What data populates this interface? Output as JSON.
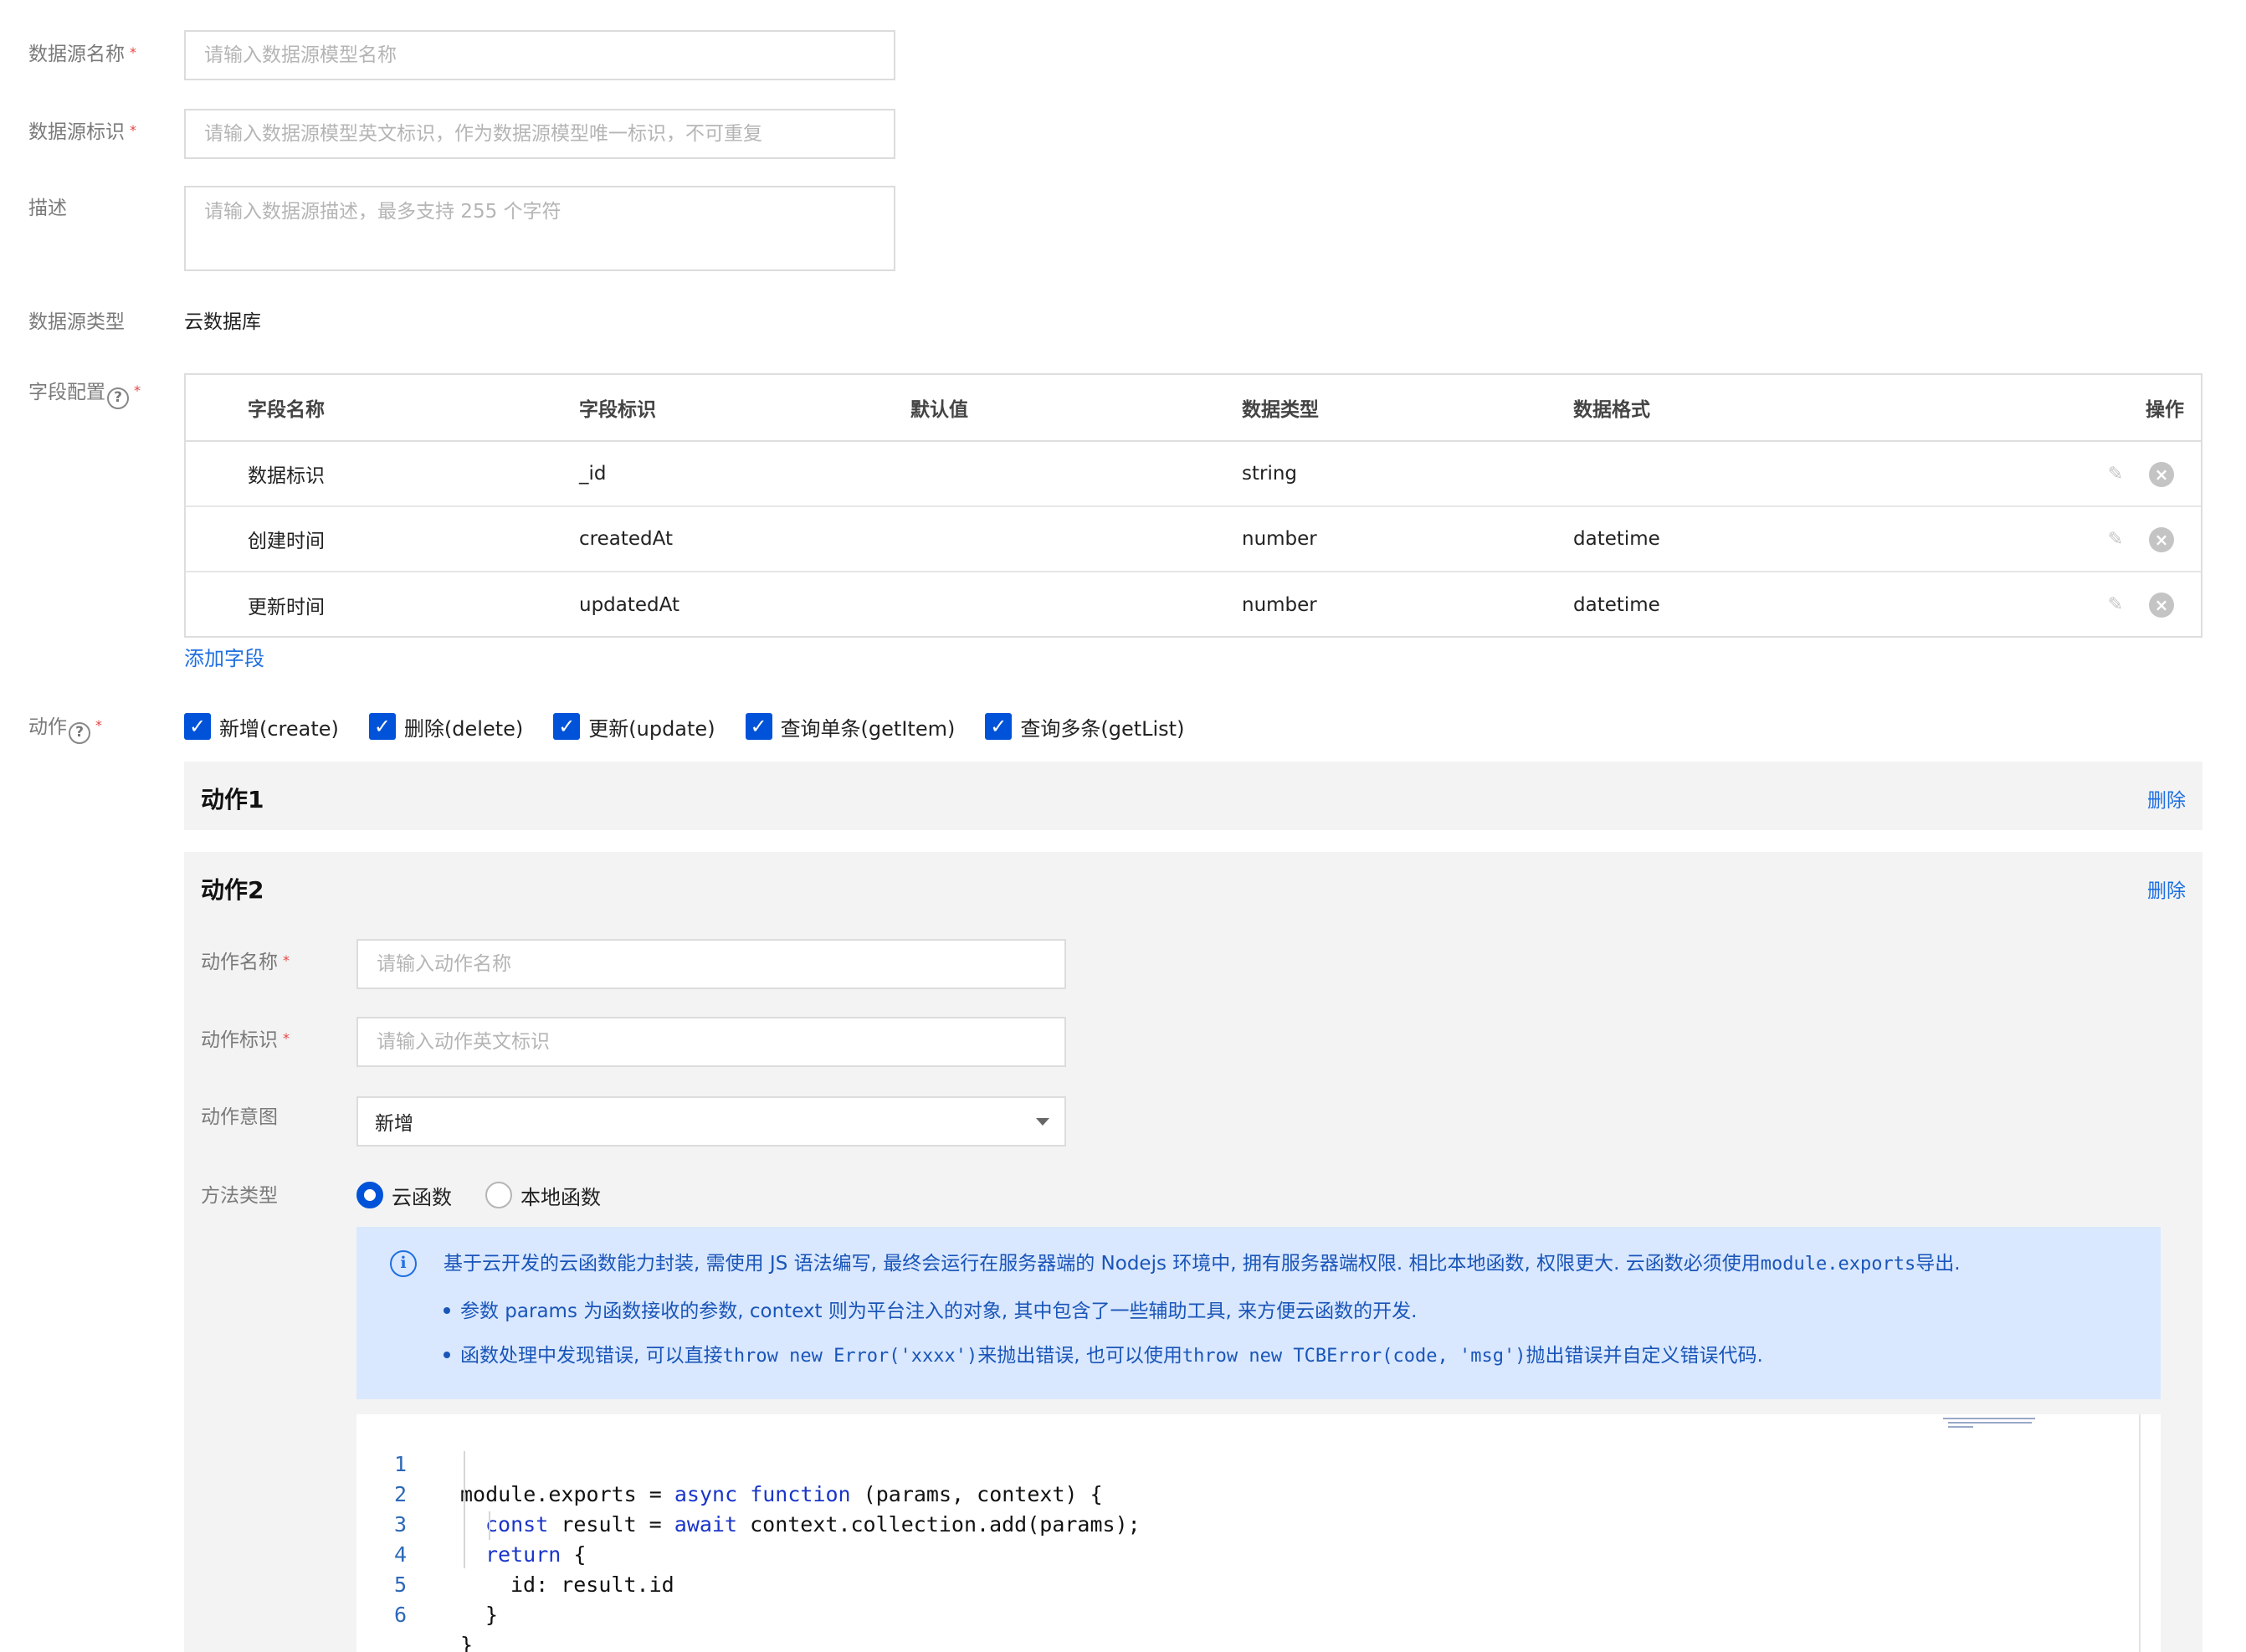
{
  "form": {
    "name": {
      "label": "数据源名称",
      "placeholder": "请输入数据源模型名称"
    },
    "identifier": {
      "label": "数据源标识",
      "placeholder": "请输入数据源模型英文标识，作为数据源模型唯一标识，不可重复"
    },
    "description": {
      "label": "描述",
      "placeholder": "请输入数据源描述，最多支持 255 个字符"
    },
    "type": {
      "label": "数据源类型",
      "value": "云数据库"
    },
    "fields": {
      "label": "字段配置"
    },
    "required_mark": "*",
    "help_glyph": "?"
  },
  "fields_table": {
    "headers": [
      "字段名称",
      "字段标识",
      "默认值",
      "数据类型",
      "数据格式",
      "操作"
    ],
    "rows": [
      {
        "name": "数据标识",
        "key": "_id",
        "default": "",
        "type": "string",
        "format": ""
      },
      {
        "name": "创建时间",
        "key": "createdAt",
        "default": "",
        "type": "number",
        "format": "datetime"
      },
      {
        "name": "更新时间",
        "key": "updatedAt",
        "default": "",
        "type": "number",
        "format": "datetime"
      }
    ],
    "add_label": "添加字段"
  },
  "actions": {
    "label": "动作",
    "options": [
      {
        "label": "新增(create)",
        "checked": true
      },
      {
        "label": "删除(delete)",
        "checked": true
      },
      {
        "label": "更新(update)",
        "checked": true
      },
      {
        "label": "查询单条(getItem)",
        "checked": true
      },
      {
        "label": "查询多条(getList)",
        "checked": true
      }
    ],
    "delete_label": "删除",
    "panels": [
      {
        "title": "动作1"
      },
      {
        "title": "动作2",
        "name": {
          "label": "动作名称",
          "placeholder": "请输入动作名称"
        },
        "identifier": {
          "label": "动作标识",
          "placeholder": "请输入动作英文标识"
        },
        "intent": {
          "label": "动作意图",
          "value": "新增"
        },
        "method": {
          "label": "方法类型",
          "options": [
            {
              "label": "云函数",
              "selected": true
            },
            {
              "label": "本地函数",
              "selected": false
            }
          ]
        },
        "info": {
          "line1": "基于云开发的云函数能力封装, 需使用 JS 语法编写, 最终会运行在服务器端的 Nodejs 环境中, 拥有服务器端权限. 相比本地函数, 权限更大. 云函数必须使用",
          "line1_code": "module.exports",
          "line1_end": "导出.",
          "line2": "参数 params 为函数接收的参数, context 则为平台注入的对象, 其中包含了一些辅助工具, 来方便云函数的开发.",
          "line3_a": "函数处理中发现错误, 可以直接",
          "line3_code1": "throw new Error('xxxx')",
          "line3_b": "来抛出错误, 也可以使用",
          "line3_code2": "throw new TCBError(code, 'msg')",
          "line3_c": "抛出错误并自定义错误代码."
        },
        "code": {
          "lines": [
            "1",
            "2",
            "3",
            "4",
            "5",
            "6"
          ],
          "tokens": {
            "l1a": "module.exports = ",
            "l1kw1": "async",
            "l1sp": " ",
            "l1kw2": "function",
            "l1b": " (params, context) {",
            "l2kw1": "const",
            "l2a": " result = ",
            "l2kw2": "await",
            "l2b": " context.collection.add(params);",
            "l3kw": "return",
            "l3a": " {",
            "l4": "id: result.id",
            "l5": "}",
            "l6": "}"
          }
        }
      }
    ]
  },
  "colors": {
    "primary": "#0052d9",
    "link": "#1f6fe0",
    "required": "#e54545",
    "info_bg": "#d9e8ff"
  },
  "icons": {
    "edit": "pencil-icon",
    "delete": "close-circle-icon",
    "info": "info-icon",
    "help": "question-circle-icon",
    "dropdown": "caret-down-icon"
  }
}
